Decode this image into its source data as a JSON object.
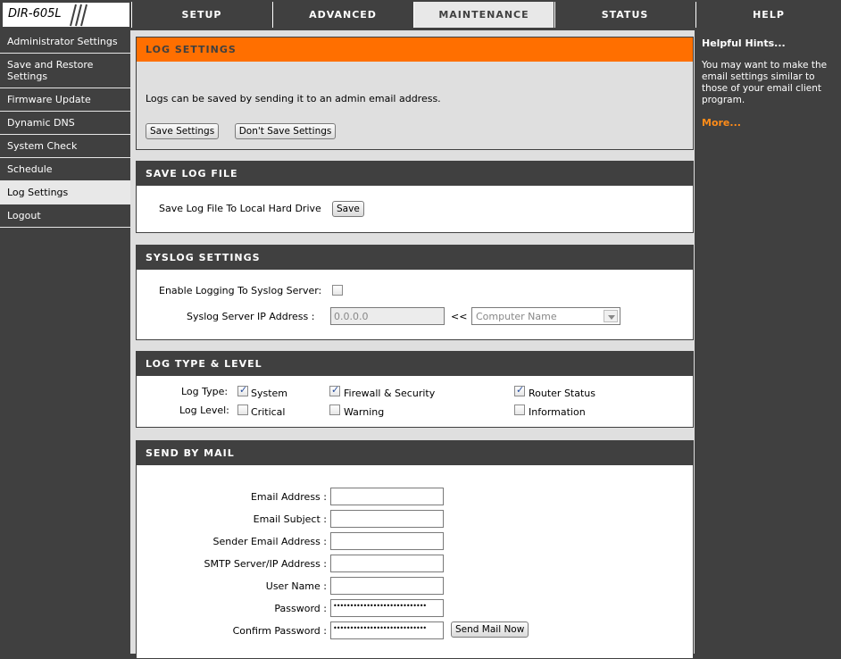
{
  "model": "DIR-605L",
  "tabs": [
    "SETUP",
    "ADVANCED",
    "MAINTENANCE",
    "STATUS",
    "HELP"
  ],
  "sidebar": [
    "Administrator Settings",
    "Save and Restore Settings",
    "Firmware Update",
    "Dynamic DNS",
    "System Check",
    "Schedule",
    "Log Settings",
    "Logout"
  ],
  "log_settings": {
    "title": "LOG SETTINGS",
    "text": "Logs can be saved by sending it to an admin email address.",
    "save_btn": "Save Settings",
    "dont_save_btn": "Don't Save Settings"
  },
  "save_log_file": {
    "title": "SAVE LOG FILE",
    "label": "Save Log File To Local Hard Drive",
    "save_btn": "Save"
  },
  "syslog": {
    "title": "SYSLOG SETTINGS",
    "enable_label": "Enable Logging To Syslog Server:",
    "ip_label": "Syslog Server IP Address :",
    "ip_value": "0.0.0.0",
    "arrow": "<<",
    "computer_name": "Computer Name"
  },
  "log_type": {
    "title": "LOG TYPE & LEVEL",
    "type_label": "Log Type:",
    "level_label": "Log Level:",
    "system": "System",
    "firewall": "Firewall & Security",
    "router": "Router Status",
    "critical": "Critical",
    "warning": "Warning",
    "information": "Information"
  },
  "mail": {
    "title": "SEND BY MAIL",
    "email_address": "Email Address :",
    "email_subject": "Email Subject :",
    "sender": "Sender Email Address :",
    "smtp": "SMTP Server/IP Address :",
    "username": "User Name :",
    "password": "Password :",
    "confirm": "Confirm Password :",
    "password_value": "••••••••••••••••••••••••••••",
    "send_btn": "Send Mail Now"
  },
  "hints": {
    "title": "Helpful Hints...",
    "text": "You may want to make the email settings similar to those of your email client program.",
    "more": "More..."
  }
}
